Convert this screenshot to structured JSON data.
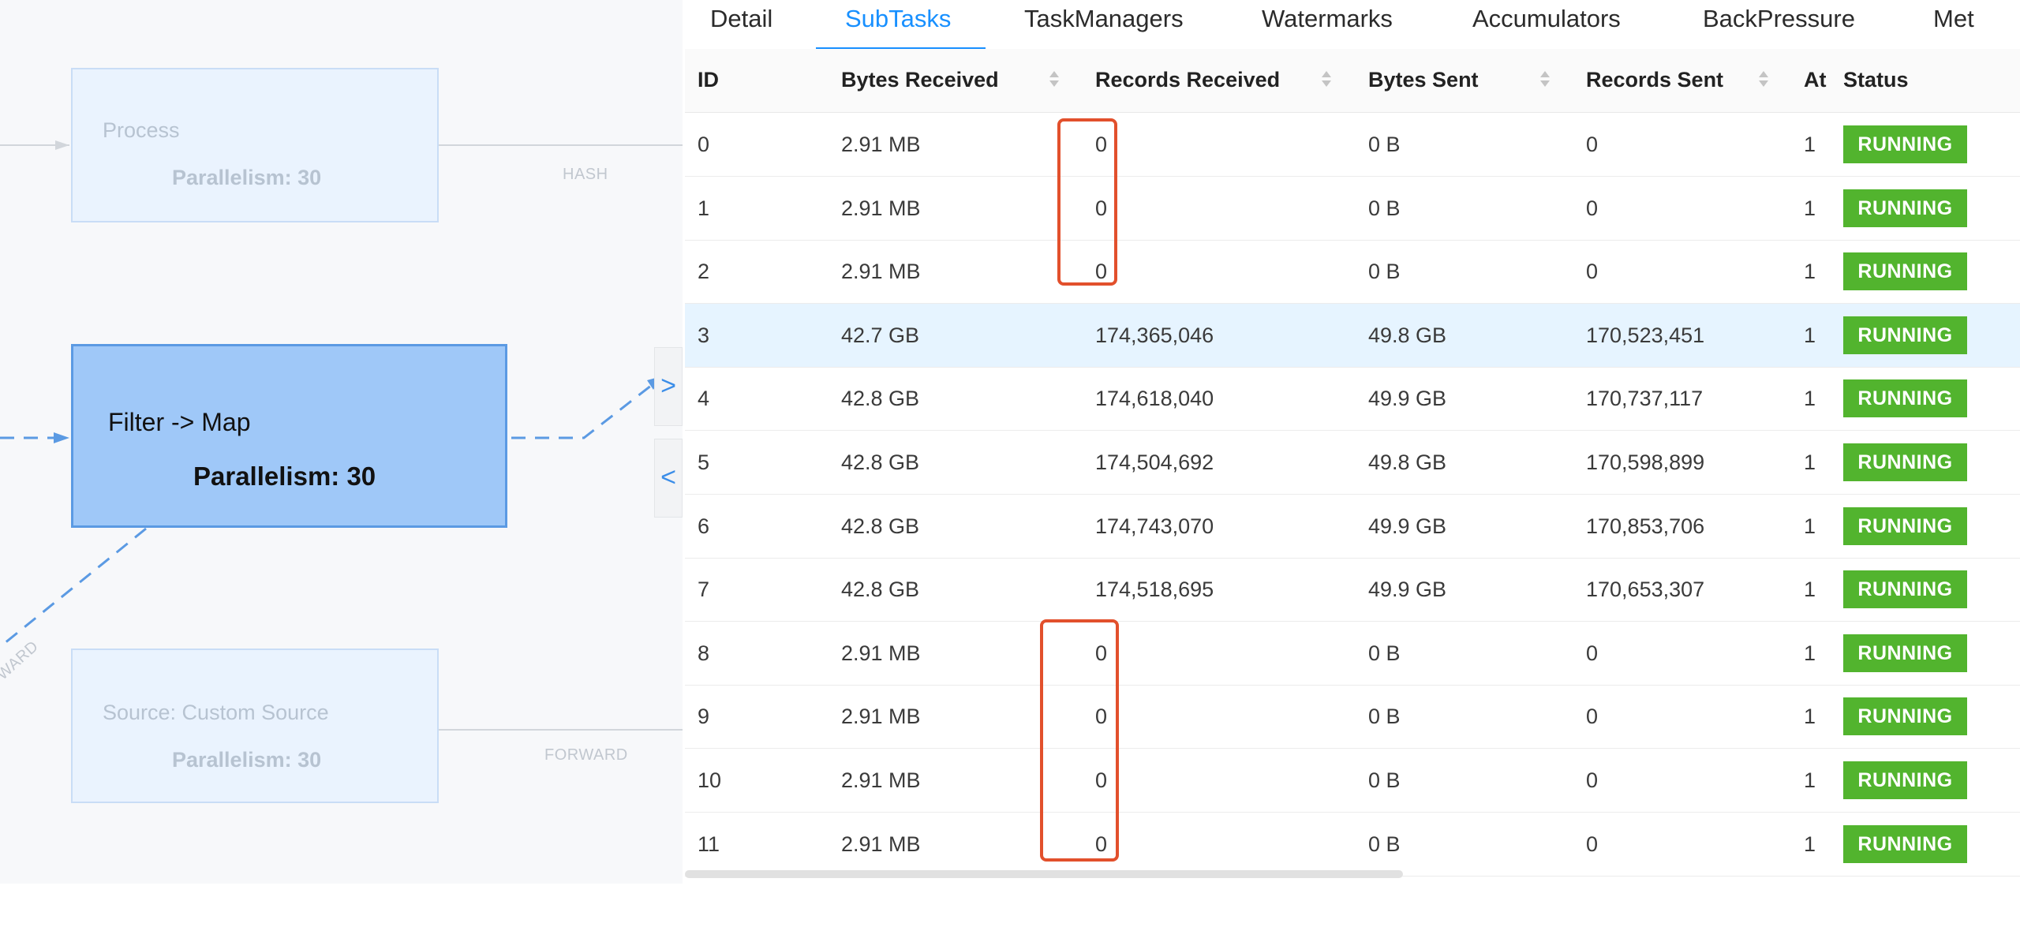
{
  "graph": {
    "nodes": [
      {
        "id": "process",
        "name": "Process",
        "parallelism": "Parallelism: 30",
        "active": false
      },
      {
        "id": "filter-map",
        "name": "Filter -> Map",
        "parallelism": "Parallelism: 30",
        "active": true
      },
      {
        "id": "source",
        "name": "Source: Custom Source",
        "parallelism": "Parallelism: 30",
        "active": false
      }
    ],
    "edge_labels": {
      "hash": "HASH",
      "forward_right": "FORWARD",
      "forward_diag": "WARD"
    },
    "colors": {
      "edge_active": "#5b9ae3",
      "edge_inactive": "#d2d6db"
    }
  },
  "panel_toggle": {
    "expand_icon": "chevron-right-icon",
    "collapse_icon": "chevron-left-icon",
    "expand_glyph": ">",
    "collapse_glyph": "<"
  },
  "tabs": [
    "Detail",
    "SubTasks",
    "TaskManagers",
    "Watermarks",
    "Accumulators",
    "BackPressure",
    "Met"
  ],
  "active_tab": "SubTasks",
  "columns": {
    "id": "ID",
    "bytes_received": "Bytes Received",
    "records_received": "Records Received",
    "bytes_sent": "Bytes Sent",
    "records_sent": "Records Sent",
    "attempt": "At",
    "status": "Status"
  },
  "rows": [
    {
      "id": "0",
      "bytes_received": "2.91 MB",
      "records_received": "0",
      "bytes_sent": "0 B",
      "records_sent": "0",
      "attempt": "1",
      "status": "RUNNING"
    },
    {
      "id": "1",
      "bytes_received": "2.91 MB",
      "records_received": "0",
      "bytes_sent": "0 B",
      "records_sent": "0",
      "attempt": "1",
      "status": "RUNNING"
    },
    {
      "id": "2",
      "bytes_received": "2.91 MB",
      "records_received": "0",
      "bytes_sent": "0 B",
      "records_sent": "0",
      "attempt": "1",
      "status": "RUNNING"
    },
    {
      "id": "3",
      "bytes_received": "42.7 GB",
      "records_received": "174,365,046",
      "bytes_sent": "49.8 GB",
      "records_sent": "170,523,451",
      "attempt": "1",
      "status": "RUNNING",
      "highlighted": true
    },
    {
      "id": "4",
      "bytes_received": "42.8 GB",
      "records_received": "174,618,040",
      "bytes_sent": "49.9 GB",
      "records_sent": "170,737,117",
      "attempt": "1",
      "status": "RUNNING"
    },
    {
      "id": "5",
      "bytes_received": "42.8 GB",
      "records_received": "174,504,692",
      "bytes_sent": "49.8 GB",
      "records_sent": "170,598,899",
      "attempt": "1",
      "status": "RUNNING"
    },
    {
      "id": "6",
      "bytes_received": "42.8 GB",
      "records_received": "174,743,070",
      "bytes_sent": "49.9 GB",
      "records_sent": "170,853,706",
      "attempt": "1",
      "status": "RUNNING"
    },
    {
      "id": "7",
      "bytes_received": "42.8 GB",
      "records_received": "174,518,695",
      "bytes_sent": "49.9 GB",
      "records_sent": "170,653,307",
      "attempt": "1",
      "status": "RUNNING"
    },
    {
      "id": "8",
      "bytes_received": "2.91 MB",
      "records_received": "0",
      "bytes_sent": "0 B",
      "records_sent": "0",
      "attempt": "1",
      "status": "RUNNING"
    },
    {
      "id": "9",
      "bytes_received": "2.91 MB",
      "records_received": "0",
      "bytes_sent": "0 B",
      "records_sent": "0",
      "attempt": "1",
      "status": "RUNNING"
    },
    {
      "id": "10",
      "bytes_received": "2.91 MB",
      "records_received": "0",
      "bytes_sent": "0 B",
      "records_sent": "0",
      "attempt": "1",
      "status": "RUNNING"
    },
    {
      "id": "11",
      "bytes_received": "2.91 MB",
      "records_received": "0",
      "bytes_sent": "0 B",
      "records_sent": "0",
      "attempt": "1",
      "status": "RUNNING"
    }
  ],
  "highlight_groups": [
    {
      "from_row": 0,
      "to_row": 2
    },
    {
      "from_row": 8,
      "to_row": 11
    }
  ],
  "colors": {
    "status_running": "#52b42e",
    "accent": "#1890ff",
    "annotation_red": "#e2502c",
    "row_highlight": "#e6f4ff"
  }
}
